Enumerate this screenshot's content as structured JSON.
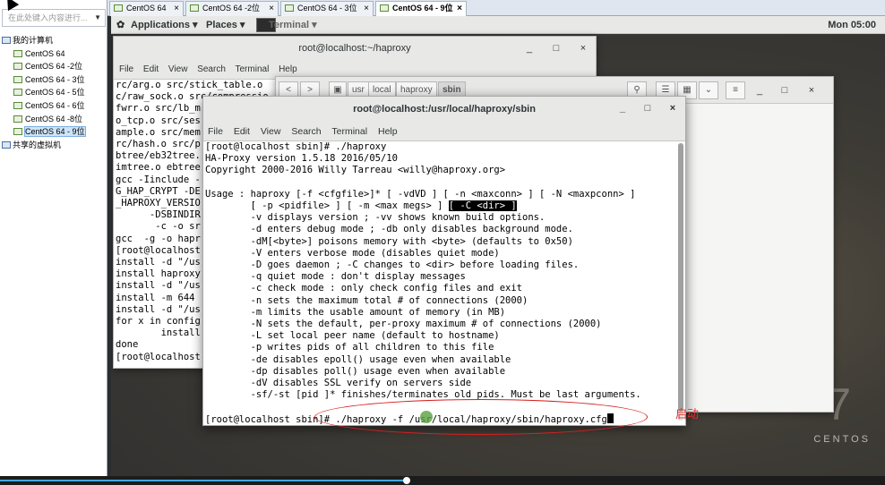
{
  "vmware": {
    "search_placeholder": "在此处键入内容进行...",
    "tree": {
      "root_label": "我的计算机",
      "children": [
        "CentOS 64",
        "CentOS 64 -2位",
        "CentOS 64 - 3位",
        "CentOS 64 - 5位",
        "CentOS 64 - 6位",
        "CentOS 64 -8位",
        "CentOS 64 - 9位"
      ],
      "selected_index": 6,
      "shared_label": "共享的虚拟机"
    },
    "tabs": [
      "CentOS 64",
      "CentOS 64 -2位",
      "CentOS 64 - 3位",
      "CentOS 64 - 9位"
    ],
    "active_tab_index": 3,
    "tab_close": "×",
    "progress_fraction": 0.46
  },
  "gnome": {
    "applications": "Applications ▾",
    "places": "Places ▾",
    "terminal_app": "Terminal ▾",
    "clock": "Mon 05:00"
  },
  "window_buttons": {
    "minimize": "_",
    "maximize": "□",
    "close": "×"
  },
  "bg_terminal": {
    "title": "root@localhost:~/haproxy",
    "menu": [
      "File",
      "Edit",
      "View",
      "Search",
      "Terminal",
      "Help"
    ],
    "lines": [
      "rc/arg.o src/stick_table.o",
      "c/raw_sock.o src/compressio",
      "fwrr.o src/lb_m",
      "o_tcp.o src/ses",
      "ample.o src/mem",
      "rc/hash.o src/p",
      "btree/eb32tree.",
      "imtree.o ebtree",
      "gcc -Iinclude -",
      "G_HAP_CRYPT -DE",
      "_HAPROXY_VERSIO",
      "      -DSBINDIR",
      "       -c -o sr",
      "gcc  -g -o hapr",
      "[root@localhost",
      "install -d \"/us",
      "install haproxy",
      "install -d \"/us",
      "install -m 644 ",
      "install -d \"/us",
      "for x in config",
      "        install",
      "done",
      "[root@localhost"
    ]
  },
  "file_manager": {
    "back": "<",
    "forward": ">",
    "crumbs": [
      "usr",
      "local",
      "haproxy",
      "sbin"
    ],
    "search_icon": "⚲",
    "list_icon": "☰",
    "grid_icon": "▦",
    "view_menu": "⌄",
    "menu_icon": "≡",
    "minimize": "_",
    "maximize": "□",
    "close": "×"
  },
  "fg_terminal": {
    "title": "root@localhost:/usr/local/haproxy/sbin",
    "menu": [
      "File",
      "Edit",
      "View",
      "Search",
      "Terminal",
      "Help"
    ],
    "lines": [
      "[root@localhost sbin]# ./haproxy",
      "HA-Proxy version 1.5.18 2016/05/10",
      "Copyright 2000-2016 Willy Tarreau <willy@haproxy.org>",
      "",
      "Usage : haproxy [-f <cfgfile>]* [ -vdVD ] [ -n <maxconn> ] [ -N <maxpconn> ]",
      "        [ -p <pidfile> ] [ -m <max megs> ] [ -C <dir> ]",
      "        -v displays version ; -vv shows known build options.",
      "        -d enters debug mode ; -db only disables background mode.",
      "        -dM[<byte>] poisons memory with <byte> (defaults to 0x50)",
      "        -V enters verbose mode (disables quiet mode)",
      "        -D goes daemon ; -C changes to <dir> before loading files.",
      "        -q quiet mode : don't display messages",
      "        -c check mode : only check config files and exit",
      "        -n sets the maximum total # of connections (2000)",
      "        -m limits the usable amount of memory (in MB)",
      "        -N sets the default, per-proxy maximum # of connections (2000)",
      "        -L set local peer name (default to hostname)",
      "        -p writes pids of all children to this file",
      "        -de disables epoll() usage even when available",
      "        -dp disables poll() usage even when available",
      "        -dV disables SSL verify on servers side",
      "        -sf/-st [pid ]* finishes/terminates old pids. Must be last arguments.",
      ""
    ],
    "usage_line_prefix": "        [ -p <pidfile> ] [ -m <max megs> ] ",
    "usage_highlight": "[ -C <dir> ]",
    "prompt_line": "[root@localhost sbin]# ./haproxy -f /usr/local/haproxy/sbin/haproxy.cfg"
  },
  "annotation": {
    "label": "启动"
  },
  "branding": {
    "seven": "7",
    "centos": "CENTOS"
  }
}
